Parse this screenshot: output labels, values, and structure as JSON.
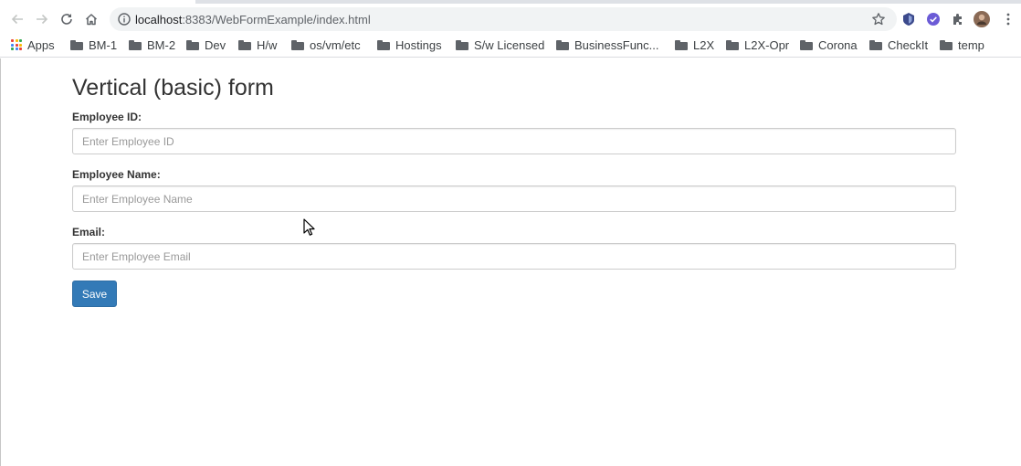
{
  "browser": {
    "url_host": "localhost",
    "url_rest": ":8383/WebFormExample/index.html",
    "bookmarks": [
      {
        "label": "Apps",
        "icon": "apps-grid-icon"
      },
      {
        "label": "BM-1",
        "icon": "folder-icon"
      },
      {
        "label": "BM-2",
        "icon": "folder-icon"
      },
      {
        "label": "Dev",
        "icon": "folder-icon"
      },
      {
        "label": "H/w",
        "icon": "folder-icon"
      },
      {
        "label": "os/vm/etc",
        "icon": "folder-icon"
      },
      {
        "label": "Hostings",
        "icon": "folder-icon"
      },
      {
        "label": "S/w Licensed",
        "icon": "folder-icon"
      },
      {
        "label": "BusinessFunc...",
        "icon": "folder-icon"
      },
      {
        "label": "L2X",
        "icon": "folder-icon"
      },
      {
        "label": "L2X-Opr",
        "icon": "folder-icon"
      },
      {
        "label": "Corona",
        "icon": "folder-icon"
      },
      {
        "label": "CheckIt",
        "icon": "folder-icon"
      },
      {
        "label": "temp",
        "icon": "folder-icon"
      }
    ]
  },
  "form": {
    "title": "Vertical (basic) form",
    "employee_id": {
      "label": "Employee ID:",
      "placeholder": "Enter Employee ID",
      "value": ""
    },
    "employee_name": {
      "label": "Employee Name:",
      "placeholder": "Enter Employee Name",
      "value": ""
    },
    "email": {
      "label": "Email:",
      "placeholder": "Enter Employee Email",
      "value": ""
    },
    "save_label": "Save"
  },
  "colors": {
    "button_primary": "#337ab7",
    "omnibox_bg": "#f1f3f4",
    "text": "#333333"
  }
}
